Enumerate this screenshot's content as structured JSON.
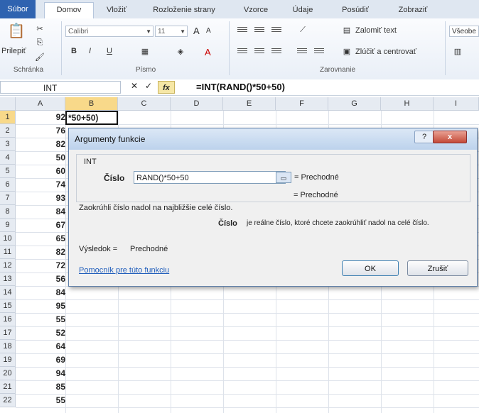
{
  "tabs": [
    "Súbor",
    "Domov",
    "Vložiť",
    "Rozloženie strany",
    "Vzorce",
    "Údaje",
    "Posúdiť",
    "Zobraziť"
  ],
  "ribbon": {
    "clipboard": {
      "paste_label": "Prilepiť",
      "group_label": "Schránka"
    },
    "font": {
      "font_name": "Calibri",
      "font_size": "11",
      "group_label": "Písmo",
      "bold": "B",
      "italic": "I",
      "underline": "U",
      "grow": "A",
      "shrink": "A",
      "font_color": "A"
    },
    "alignment": {
      "wrap_text": "Zalomiť text",
      "merge_center": "Zlúčiť a centrovať",
      "group_label": "Zarovnanie"
    },
    "number": {
      "format": "Všeobe"
    }
  },
  "formula_bar": {
    "name_box": "INT",
    "formula": "=INT(RAND()*50+50)",
    "fx": "fx"
  },
  "columns": [
    "A",
    "B",
    "C",
    "D",
    "E",
    "F",
    "G",
    "H",
    "I"
  ],
  "rows": [
    "1",
    "2",
    "3",
    "4",
    "5",
    "6",
    "7",
    "8",
    "9",
    "10",
    "11",
    "12",
    "13",
    "14",
    "15",
    "16",
    "17",
    "18",
    "19",
    "20",
    "21",
    "22"
  ],
  "colA": [
    "92",
    "76",
    "82",
    "50",
    "60",
    "74",
    "93",
    "84",
    "67",
    "65",
    "82",
    "72",
    "56",
    "84",
    "95",
    "55",
    "52",
    "64",
    "69",
    "94",
    "85",
    "55"
  ],
  "active_cell_text": "*50+50)",
  "dialog": {
    "title": "Argumenty funkcie",
    "function_name": "INT",
    "arg_label": "Číslo",
    "arg_value": "RAND()*50+50",
    "arg_result": "= Prechodné",
    "total_result": "= Prechodné",
    "description": "Zaokrúhli číslo nadol na najbližšie celé číslo.",
    "arg_help_label": "Číslo",
    "arg_help_text": "je reálne číslo, ktoré chcete zaokrúhliť nadol na celé číslo.",
    "result_label": "Výsledok =",
    "result_value": "Prechodné",
    "help_link": "Pomocník pre túto funkciu",
    "ok": "OK",
    "cancel": "Zrušiť",
    "help_btn": "?",
    "close_btn": "x"
  }
}
